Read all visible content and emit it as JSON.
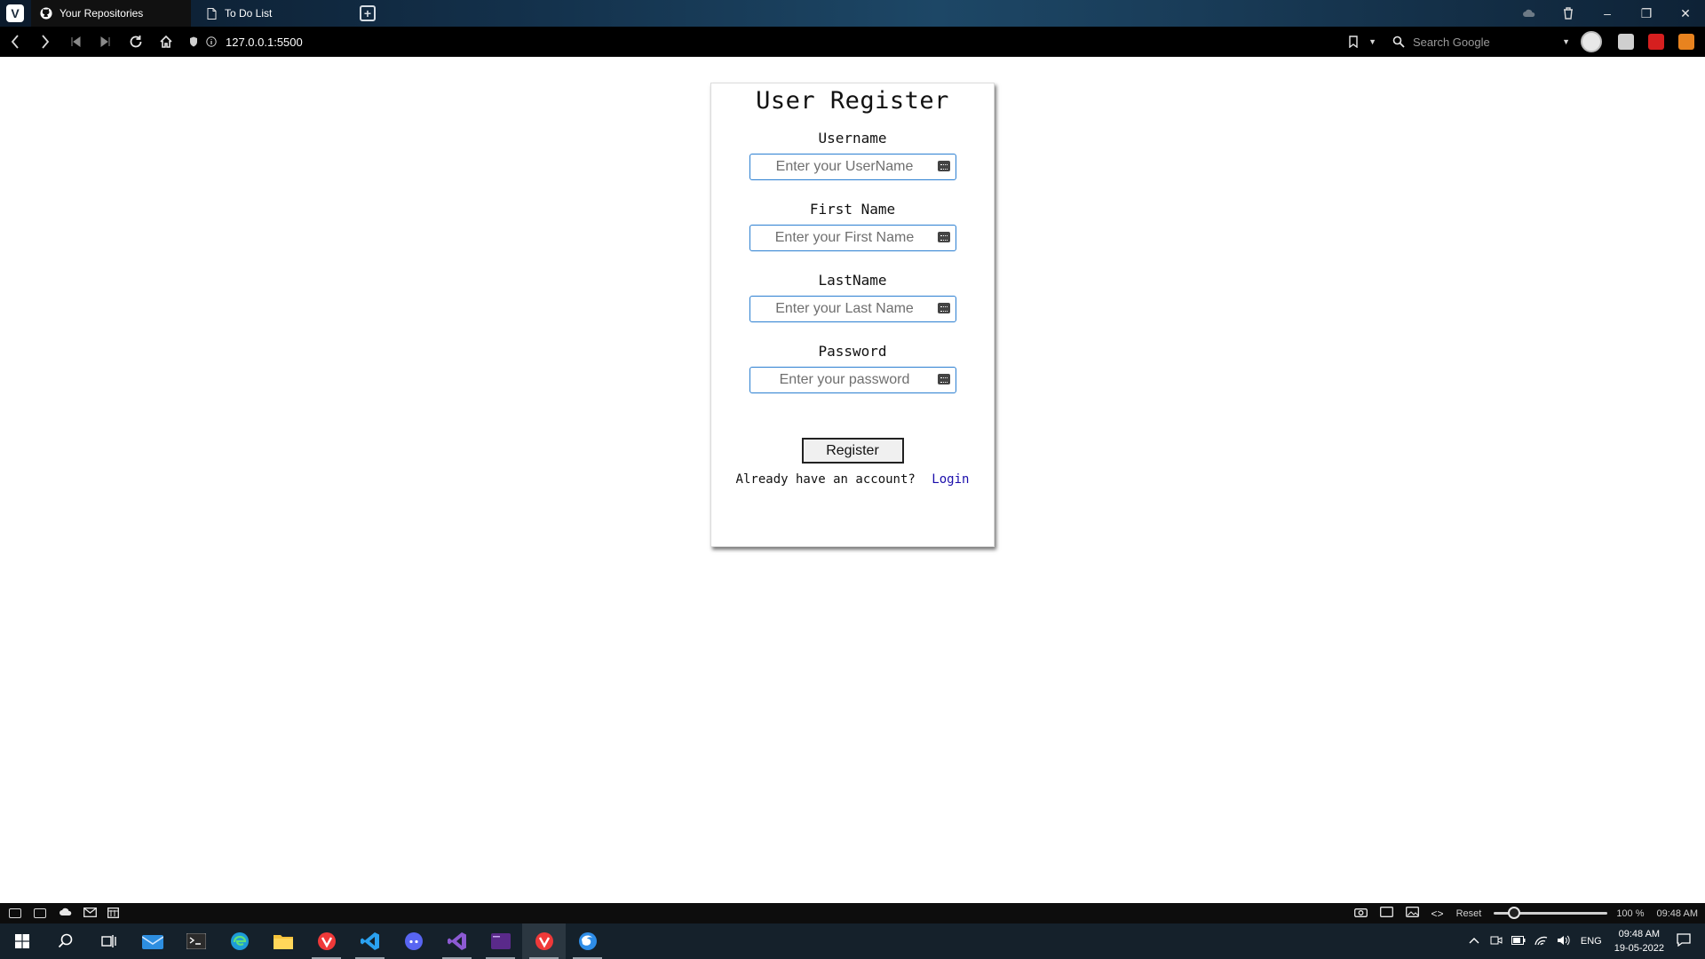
{
  "browser": {
    "menu_icon_letter": "V",
    "tabs": [
      {
        "label": "Your Repositories",
        "icon": "github-icon",
        "active": true
      },
      {
        "label": "To Do List",
        "icon": "page-icon",
        "active": false
      }
    ],
    "new_tab_label": "+",
    "window_controls": {
      "minimize": "–",
      "restore": "❐",
      "close": "✕"
    },
    "address": {
      "url": "127.0.0.1:5500",
      "search_placeholder": "Search Google"
    }
  },
  "page": {
    "title": "User Register",
    "fields": [
      {
        "label": "Username",
        "placeholder": "Enter your UserName"
      },
      {
        "label": "First Name",
        "placeholder": "Enter your First Name"
      },
      {
        "label": "LastName",
        "placeholder": "Enter your Last Name"
      },
      {
        "label": "Password",
        "placeholder": "Enter your password"
      }
    ],
    "register_button": "Register",
    "login_prompt": "Already have an account?",
    "login_link": "Login"
  },
  "statusbar": {
    "reset_label": "Reset",
    "zoom_label": "100 %",
    "zoom_percent": 100,
    "time": "09:48 AM"
  },
  "taskbar": {
    "apps": [
      "windows-start-icon",
      "search-icon",
      "task-view-icon",
      "mail-icon",
      "terminal-icon",
      "edge-icon",
      "file-explorer-icon",
      "vivaldi-icon",
      "vscode-icon",
      "discord-icon",
      "visual-studio-icon",
      "vs-code-purple-icon",
      "vivaldi-active-icon",
      "firefox-icon"
    ],
    "language": "ENG",
    "clock_time": "09:48 AM",
    "clock_date": "19-05-2022"
  },
  "colors": {
    "accent_input_border": "#2b7fd1",
    "link": "#1a0dab",
    "taskbar": "#15212b"
  }
}
